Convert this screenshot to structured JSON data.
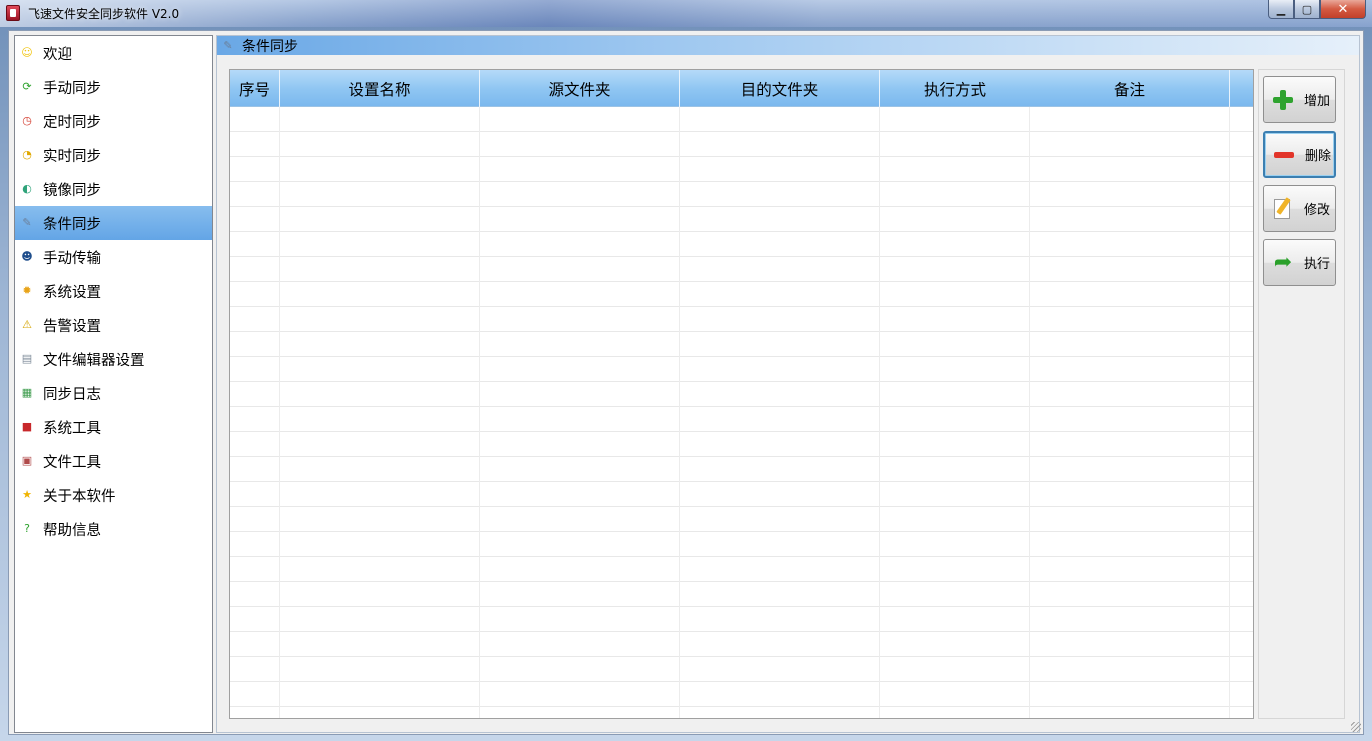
{
  "window": {
    "title": "飞速文件安全同步软件 V2.0",
    "minimize_glyph": "▁",
    "maximize_glyph": "▢",
    "close_glyph": "✕"
  },
  "sidebar": {
    "items": [
      {
        "label": "欢迎",
        "icon": "smiley-icon",
        "glyph": "☺",
        "color": "#f1c40f",
        "active": false
      },
      {
        "label": "手动同步",
        "icon": "sync-arrows-icon",
        "glyph": "⟳",
        "color": "#2fa32f",
        "active": false
      },
      {
        "label": "定时同步",
        "icon": "alarm-clock-icon",
        "glyph": "◷",
        "color": "#d33a2c",
        "active": false
      },
      {
        "label": "实时同步",
        "icon": "clock-icon",
        "glyph": "◔",
        "color": "#e0a800",
        "active": false
      },
      {
        "label": "镜像同步",
        "icon": "mirror-icon",
        "glyph": "◐",
        "color": "#2fa37a",
        "active": false
      },
      {
        "label": "条件同步",
        "icon": "document-pen-icon",
        "glyph": "✎",
        "color": "#6b7f99",
        "active": true
      },
      {
        "label": "手动传输",
        "icon": "user-icon",
        "glyph": "☻",
        "color": "#1f4e8c",
        "active": false
      },
      {
        "label": "系统设置",
        "icon": "gear-icon",
        "glyph": "✹",
        "color": "#e8a317",
        "active": false
      },
      {
        "label": "告警设置",
        "icon": "warning-icon",
        "glyph": "⚠",
        "color": "#d4a400",
        "active": false
      },
      {
        "label": "文件编辑器设置",
        "icon": "file-editor-icon",
        "glyph": "▤",
        "color": "#7f8c9a",
        "active": false
      },
      {
        "label": "同步日志",
        "icon": "log-icon",
        "glyph": "▦",
        "color": "#3a9a4a",
        "active": false
      },
      {
        "label": "系统工具",
        "icon": "toolbox-icon",
        "glyph": "■",
        "color": "#c8282b",
        "active": false
      },
      {
        "label": "文件工具",
        "icon": "file-tool-icon",
        "glyph": "▣",
        "color": "#b04a4a",
        "active": false
      },
      {
        "label": "关于本软件",
        "icon": "folder-star-icon",
        "glyph": "★",
        "color": "#f0b400",
        "active": false
      },
      {
        "label": "帮助信息",
        "icon": "help-icon",
        "glyph": "?",
        "color": "#2fa32f",
        "active": false
      }
    ]
  },
  "panel": {
    "title": "条件同步",
    "icon": "document-pen-icon",
    "icon_glyph": "✎"
  },
  "table": {
    "columns": [
      "序号",
      "设置名称",
      "源文件夹",
      "目的文件夹",
      "执行方式",
      "备注"
    ],
    "rows": []
  },
  "actions": {
    "add_label": "增加",
    "delete_label": "删除",
    "edit_label": "修改",
    "execute_label": "执行",
    "execute_glyph": "➦"
  },
  "colors": {
    "selection": "#63a5e6",
    "header": "#8ec5f2",
    "add": "#2fa32f",
    "delete": "#e2352a"
  }
}
